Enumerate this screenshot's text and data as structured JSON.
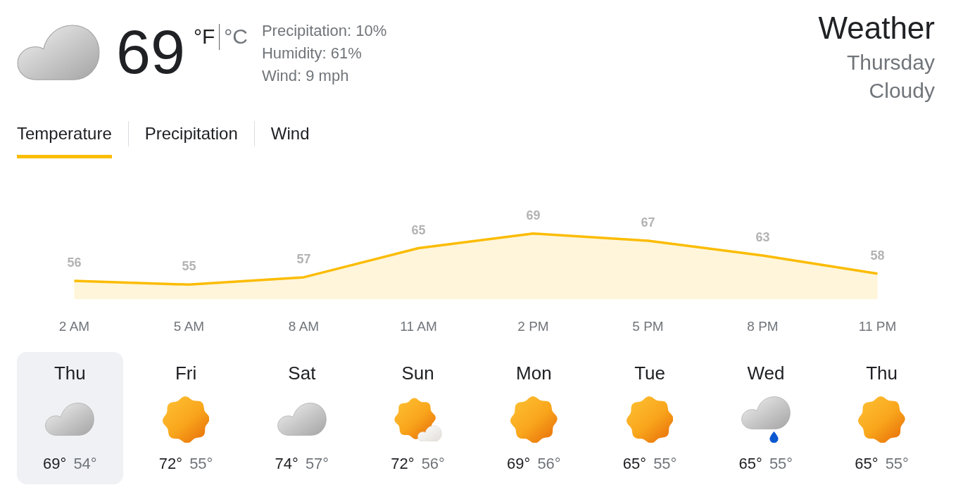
{
  "current": {
    "kind": "cloudy",
    "temperature": "69",
    "units": [
      {
        "label": "°F",
        "selected": true
      },
      {
        "label": "°C",
        "selected": false
      }
    ],
    "details": [
      "Precipitation: 10%",
      "Humidity: 61%",
      "Wind: 9 mph"
    ]
  },
  "heading": {
    "title": "Weather",
    "day": "Thursday",
    "condition": "Cloudy"
  },
  "tabs": [
    {
      "label": "Temperature",
      "selected": true
    },
    {
      "label": "Precipitation",
      "selected": false
    },
    {
      "label": "Wind",
      "selected": false
    }
  ],
  "chart": {
    "chart_data": {
      "type": "area",
      "categories": [
        "2 AM",
        "5 AM",
        "8 AM",
        "11 AM",
        "2 PM",
        "5 PM",
        "8 PM",
        "11 PM"
      ],
      "series": [
        {
          "color": "#fbbc04",
          "values": [
            56,
            55,
            57,
            65,
            69,
            67,
            63,
            58
          ]
        }
      ],
      "data_labels": true
    }
  },
  "days": [
    {
      "name": "Thu",
      "kind": "cloudy",
      "high": "69°",
      "low": "54°",
      "selected": true
    },
    {
      "name": "Fri",
      "kind": "sunny",
      "high": "72°",
      "low": "55°",
      "selected": false
    },
    {
      "name": "Sat",
      "kind": "cloudy",
      "high": "74°",
      "low": "57°",
      "selected": false
    },
    {
      "name": "Sun",
      "kind": "partlycloudy",
      "high": "72°",
      "low": "56°",
      "selected": false
    },
    {
      "name": "Mon",
      "kind": "sunny",
      "high": "69°",
      "low": "56°",
      "selected": false
    },
    {
      "name": "Tue",
      "kind": "sunny",
      "high": "65°",
      "low": "55°",
      "selected": false
    },
    {
      "name": "Wed",
      "kind": "rain",
      "high": "65°",
      "low": "55°",
      "selected": false
    },
    {
      "name": "Thu",
      "kind": "sunny",
      "high": "65°",
      "low": "55°",
      "selected": false
    }
  ]
}
